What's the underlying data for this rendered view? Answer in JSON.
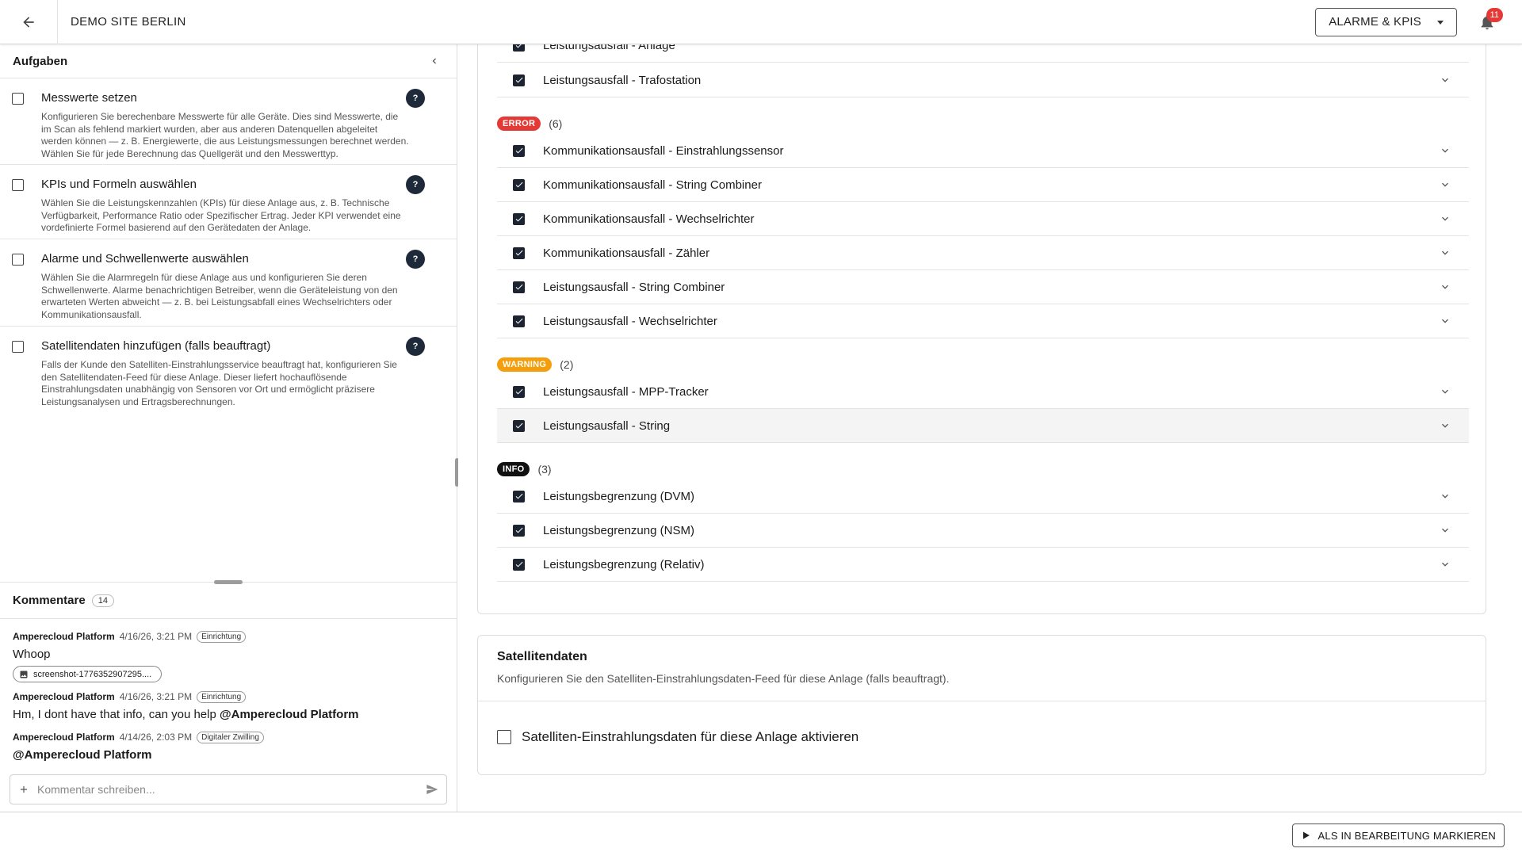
{
  "header": {
    "site_title": "DEMO SITE BERLIN",
    "alarms_button": "ALARME & KPIS",
    "notification_count": "11"
  },
  "tasks": {
    "title": "Aufgaben",
    "items": [
      {
        "title": "Messwerte setzen",
        "description": "Konfigurieren Sie berechenbare Messwerte für alle Geräte. Dies sind Messwerte, die im Scan als fehlend markiert wurden, aber aus anderen Datenquellen abgeleitet werden können — z. B. Energiewerte, die aus Leistungsmessungen berechnet werden. Wählen Sie für jede Berechnung das Quellgerät und den Messwerttyp."
      },
      {
        "title": "KPIs und Formeln auswählen",
        "description": "Wählen Sie die Leistungskennzahlen (KPIs) für diese Anlage aus, z. B. Technische Verfügbarkeit, Performance Ratio oder Spezifischer Ertrag. Jeder KPI verwendet eine vordefinierte Formel basierend auf den Gerätedaten der Anlage."
      },
      {
        "title": "Alarme und Schwellenwerte auswählen",
        "description": "Wählen Sie die Alarmregeln für diese Anlage aus und konfigurieren Sie deren Schwellenwerte. Alarme benachrichtigen Betreiber, wenn die Geräteleistung von den erwarteten Werten abweicht — z. B. bei Leistungsabfall eines Wechselrichters oder Kommunikationsausfall."
      },
      {
        "title": "Satellitendaten hinzufügen (falls beauftragt)",
        "description": "Falls der Kunde den Satelliten-Einstrahlungsservice beauftragt hat, konfigurieren Sie den Satellitendaten-Feed für diese Anlage. Dieser liefert hochauflösende Einstrahlungsdaten unabhängig von Sensoren vor Ort und ermöglicht präzisere Leistungsanalysen und Ertragsberechnungen."
      }
    ],
    "help_symbol": "?"
  },
  "comments": {
    "title": "Kommentare",
    "count": "14",
    "items": [
      {
        "author": "Amperecloud Platform",
        "time": "4/16/26, 3:21 PM",
        "tag": "Einrichtung",
        "body": "Whoop",
        "attachment": "screenshot-1776352907295...."
      },
      {
        "author": "Amperecloud Platform",
        "time": "4/16/26, 3:21 PM",
        "tag": "Einrichtung",
        "body": "Hm, I dont have that info, can you help ",
        "mention": "@Amperecloud Platform"
      },
      {
        "author": "Amperecloud Platform",
        "time": "4/14/26, 2:03 PM",
        "tag": "Digitaler Zwilling",
        "mention": "@Amperecloud Platform"
      }
    ],
    "input_placeholder": "Kommentar schreiben..."
  },
  "alarms": {
    "partial_top_label": "Leistungsausfall - Anlage",
    "top_items": [
      "Leistungsausfall - Trafostation"
    ],
    "groups": [
      {
        "severity": "ERROR",
        "count": "(6)",
        "color": "#e53935",
        "items": [
          "Kommunikationsausfall - Einstrahlungssensor",
          "Kommunikationsausfall - String Combiner",
          "Kommunikationsausfall - Wechselrichter",
          "Kommunikationsausfall - Zähler",
          "Leistungsausfall - String Combiner",
          "Leistungsausfall - Wechselrichter"
        ]
      },
      {
        "severity": "WARNING",
        "count": "(2)",
        "color": "#f59e0b",
        "items": [
          "Leistungsausfall - MPP-Tracker",
          "Leistungsausfall - String"
        ]
      },
      {
        "severity": "INFO",
        "count": "(3)",
        "color": "#111111",
        "items": [
          "Leistungsbegrenzung (DVM)",
          "Leistungsbegrenzung (NSM)",
          "Leistungsbegrenzung (Relativ)"
        ]
      }
    ]
  },
  "satellite": {
    "title": "Satellitendaten",
    "description": "Konfigurieren Sie den Satelliten-Einstrahlungsdaten-Feed für diese Anlage (falls beauftragt).",
    "option_label": "Satelliten-Einstrahlungsdaten für diese Anlage aktivieren"
  },
  "footer": {
    "mark_button": "ALS IN BEARBEITUNG MARKIEREN"
  }
}
